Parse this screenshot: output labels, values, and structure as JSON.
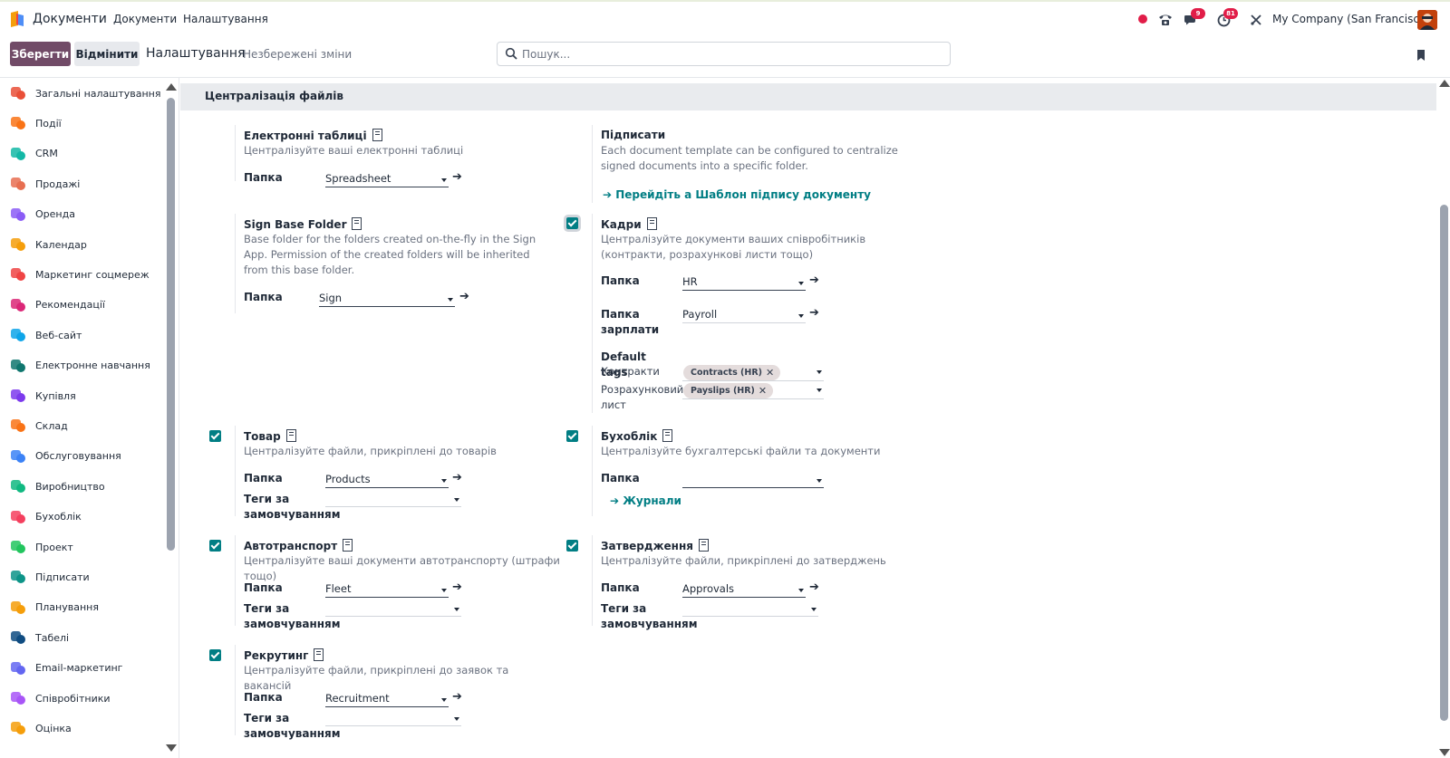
{
  "navbar": {
    "app_name": "Документи",
    "links": [
      "Документи",
      "Налаштування"
    ],
    "messages_badge": "9",
    "activities_badge": "81",
    "company": "My Company (San Francisco)"
  },
  "control": {
    "save_label": "Зберегти",
    "discard_label": "Відмінити",
    "breadcrumb": "Налаштування",
    "unsaved": "Незбережені зміни",
    "search_placeholder": "Пошук..."
  },
  "sidebar": {
    "items": [
      {
        "label": "Загальні налаштування",
        "icon": "settings-app-icon",
        "color": "#e94f37"
      },
      {
        "label": "Події",
        "icon": "events-app-icon",
        "color": "#f97316"
      },
      {
        "label": "CRM",
        "icon": "crm-app-icon",
        "color": "#14b8a6"
      },
      {
        "label": "Продажі",
        "icon": "sales-app-icon",
        "color": "#e76f51"
      },
      {
        "label": "Оренда",
        "icon": "rental-app-icon",
        "color": "#8b5cf6"
      },
      {
        "label": "Календар",
        "icon": "calendar-app-icon",
        "color": "#f59e0b"
      },
      {
        "label": "Маркетинг соцмереж",
        "icon": "social-marketing-app-icon",
        "color": "#ef4444"
      },
      {
        "label": "Рекомендації",
        "icon": "referrals-app-icon",
        "color": "#db2777"
      },
      {
        "label": "Веб-сайт",
        "icon": "website-app-icon",
        "color": "#0ea5e9"
      },
      {
        "label": "Електронне навчання",
        "icon": "elearning-app-icon",
        "color": "#0f766e"
      },
      {
        "label": "Купівля",
        "icon": "purchase-app-icon",
        "color": "#7c3aed"
      },
      {
        "label": "Склад",
        "icon": "inventory-app-icon",
        "color": "#f97316"
      },
      {
        "label": "Обслуговування",
        "icon": "maintenance-app-icon",
        "color": "#3b82f6"
      },
      {
        "label": "Виробництво",
        "icon": "manufacturing-app-icon",
        "color": "#10b981"
      },
      {
        "label": "Бухоблік",
        "icon": "accounting-app-icon",
        "color": "#f43f5e"
      },
      {
        "label": "Проект",
        "icon": "project-app-icon",
        "color": "#22c55e"
      },
      {
        "label": "Підписати",
        "icon": "sign-app-icon",
        "color": "#0d9488"
      },
      {
        "label": "Планування",
        "icon": "planning-app-icon",
        "color": "#f59e0b"
      },
      {
        "label": "Табелі",
        "icon": "timesheets-app-icon",
        "color": "#0f4c81"
      },
      {
        "label": "Email-маркетинг",
        "icon": "email-marketing-app-icon",
        "color": "#6366f1"
      },
      {
        "label": "Співробітники",
        "icon": "employees-app-icon",
        "color": "#a855f7"
      },
      {
        "label": "Оцінка",
        "icon": "appraisal-app-icon",
        "color": "#f59e0b"
      }
    ]
  },
  "section": {
    "title": "Централізація файлів"
  },
  "spreadsheet": {
    "title": "Електронні таблиці",
    "desc": "Централізуйте ваші електронні таблиці",
    "folder_label": "Папка",
    "folder_value": "Spreadsheet"
  },
  "sign": {
    "title": "Підписати",
    "desc": "Each document template can be configured to centralize signed documents into a specific folder.",
    "link": "Перейдіть а Шаблон підпису документу"
  },
  "sign_base": {
    "title": "Sign Base Folder",
    "desc": "Base folder for the folders created on-the-fly in the Sign App. Permission of the created folders will be inherited from this base folder.",
    "folder_label": "Папка",
    "folder_value": "Sign"
  },
  "hr": {
    "title": "Кадри",
    "desc": "Централізуйте документи ваших співробітників (контракти, розрахункові листи тощо)",
    "folder_label": "Папка",
    "folder_value": "HR",
    "payroll_label": "Папка зарплати",
    "payroll_value": "Payroll",
    "tags_label": "Default tags",
    "contracts_label": "Контракти",
    "contracts_tag": "Contracts (HR)",
    "payslip_label": "Розрахунковий лист",
    "payslip_tag": "Payslips (HR)"
  },
  "product": {
    "title": "Товар",
    "desc": "Централізуйте файли, прикріплені до товарів",
    "folder_label": "Папка",
    "folder_value": "Products",
    "tags_label": "Теги за замовчуванням"
  },
  "accounting": {
    "title": "Бухоблік",
    "desc": "Централізуйте бухгалтерські файли та документи",
    "folder_label": "Папка",
    "folder_value": "",
    "link": "Журнали"
  },
  "fleet": {
    "title": "Автотранспорт",
    "desc": "Централізуйте ваші документи автотранспорту (штрафи тощо)",
    "folder_label": "Папка",
    "folder_value": "Fleet",
    "tags_label": "Теги за замовчуванням"
  },
  "approvals": {
    "title": "Затвердження",
    "desc": "Централізуйте файли, прикріплені до затверджень",
    "folder_label": "Папка",
    "folder_value": "Approvals",
    "tags_label": "Теги за замовчуванням"
  },
  "recruitment": {
    "title": "Рекрутинг",
    "desc": "Централізуйте файли, прикріплені до заявок та вакансій",
    "folder_label": "Папка",
    "folder_value": "Recruitment",
    "tags_label": "Теги за замовчуванням"
  },
  "colors": {
    "primary": "#714b67",
    "teal": "#017e84",
    "badge": "#e11d48"
  }
}
